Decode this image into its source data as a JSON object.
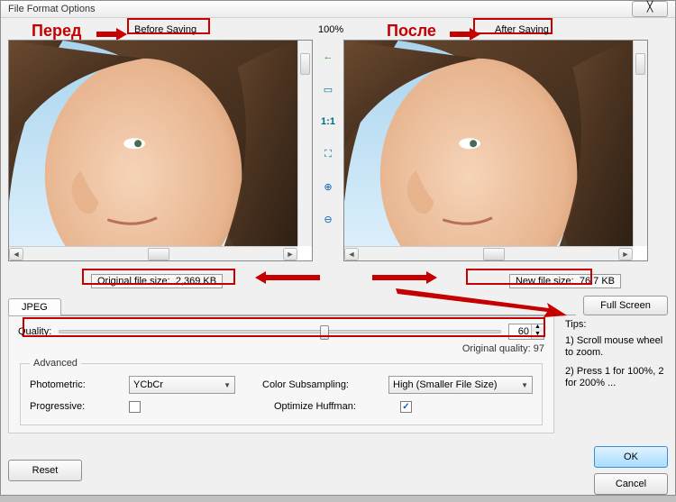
{
  "window": {
    "title": "File Format Options"
  },
  "annotations": {
    "before_ru": "Перед",
    "after_ru": "После"
  },
  "header": {
    "before_label": "Before Saving",
    "percent": "100%",
    "after_label": "After Saving"
  },
  "sizes": {
    "original_label": "Original file size:",
    "original_value": "2,369 KB",
    "new_label": "New file size:",
    "new_value": "76.7 KB"
  },
  "toolbar_icons": {
    "back": "←",
    "fit": "▭",
    "one_to_one": "1:1",
    "fit_screen": "⛶",
    "zoom_in": "⊕",
    "zoom_out": "⊖"
  },
  "tab": {
    "jpeg": "JPEG"
  },
  "full_screen": "Full Screen",
  "quality": {
    "label": "Quality:",
    "value": "60",
    "percent": 60,
    "original_label": "Original quality:",
    "original_value": "97"
  },
  "advanced": {
    "legend": "Advanced",
    "photometric_label": "Photometric:",
    "photometric_value": "YCbCr",
    "progressive_label": "Progressive:",
    "progressive_checked": false,
    "subsampling_label": "Color Subsampling:",
    "subsampling_value": "High (Smaller File Size)",
    "huffman_label": "Optimize Huffman:",
    "huffman_checked": true
  },
  "tips": {
    "heading": "Tips:",
    "line1": "1) Scroll mouse wheel to zoom.",
    "line2": "2) Press 1 for 100%, 2 for 200% ..."
  },
  "buttons": {
    "reset": "Reset",
    "ok": "OK",
    "cancel": "Cancel"
  }
}
